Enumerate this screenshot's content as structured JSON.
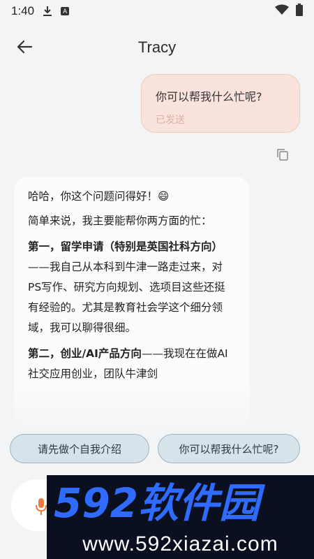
{
  "status_bar": {
    "time": "1:40",
    "a_badge": "A"
  },
  "header": {
    "title": "Tracy"
  },
  "user_message": {
    "text": "你可以帮我什么忙呢?",
    "status": "已发送"
  },
  "bot_message": {
    "line1": "哈哈，你这个问题问得好！😄",
    "line2": "简单来说，我主要能帮你两方面的忙：",
    "p3_bold": "第一，留学申请（特别是英国社科方向）",
    "p3_rest": "——我自己从本科到牛津一路走过来，对PS写作、研究方向规划、选项目这些还挺有经验的。尤其是教育社会学这个细分领域，我可以聊得很细。",
    "p4_bold": "第二，创业/AI产品方向",
    "p4_rest": "——我现在在做AI社交应用创业，团队牛津剑"
  },
  "suggestions": [
    "请先做个自我介绍",
    "你可以帮我什么忙呢?"
  ],
  "watermark": {
    "brand": "592软件园",
    "url": "www.592xiazai.com"
  },
  "colors": {
    "accent": "#f07a3c",
    "watermark_blue": "#2f6bff"
  }
}
